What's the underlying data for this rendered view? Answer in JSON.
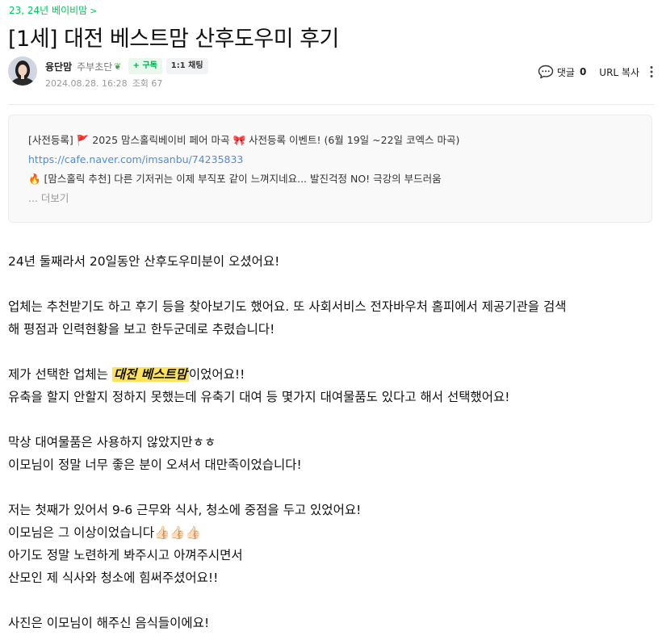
{
  "breadcrumb": {
    "label": "23, 24년 베이비맘"
  },
  "post": {
    "title": "[1세] 대전 베스트맘 산후도우미 후기",
    "author": {
      "name": "융단맘",
      "grade": "주부초단",
      "follow_label": "+ 구독",
      "chat_label": "1:1 채팅"
    },
    "date": "2024.08.28. 16:28",
    "views_label": "조회 67"
  },
  "actions": {
    "comment_label": "댓글",
    "comment_count": "0",
    "url_copy_label": "URL 복사"
  },
  "notice": {
    "line1": "[사전등록] 🚩 2025 맘스홀릭베이비 페어 마곡 🎀 사전등록 이벤트! (6월 19일 ~22일 코엑스 마곡)",
    "link": "https://cafe.naver.com/imsanbu/74235833",
    "line3": "🔥 [맘스홀릭 추천] 다른 기저귀는 이제 부직포 같이 느껴지네요... 발진걱정 NO! 극강의 부드러움",
    "more_label": "... 더보기"
  },
  "content": {
    "p1": "24년 둘째라서 20일동안 산후도우미분이 오셨어요!",
    "p2a": "업체는 추천받기도 하고 후기 등을 찾아보기도 했어요. 또 사회서비스 전자바우처 홈피에서 제공기관을  검색",
    "p2b": "해 평점과 인력현황을 보고 한두군데로 추렸습니다!",
    "p3_pre": "제가 선택한 업체는 ",
    "p3_highlight": "대전 베스트맘",
    "p3_post": "이었어요!!",
    "p4": "유축을 할지 안할지 정하지 못했는데 유축기 대여 등 몇가지 대여물품도 있다고 해서 선택했어요!",
    "p5": "막상 대여물품은 사용하지 않았지만ㅎㅎ",
    "p6": "이모님이 정말 너무 좋은 분이 오셔서 대만족이었습니다!",
    "p7": "저는 첫째가 있어서 9-6 근무와 식사, 청소에 중점을 두고 있었어요!",
    "p8": "이모님은 그 이상이었습니다👍🏻👍🏻👍🏻",
    "p9": "아기도 정말 노련하게 봐주시고 아껴주시면서",
    "p10": "산모인 제 식사와 청소에 힘써주셨어요!!",
    "p11": "사진은 이모님이 해주신 음식들이에요!"
  },
  "icons": {
    "breadcrumb_chevron": "chevron-right-icon",
    "comment": "comment-bubble-icon",
    "more": "more-vertical-icon",
    "sprout": "sprout-icon"
  },
  "colors": {
    "accent_green": "#03c75a",
    "link_blue": "#4b8de0",
    "highlight_yellow": "#fde25a"
  }
}
